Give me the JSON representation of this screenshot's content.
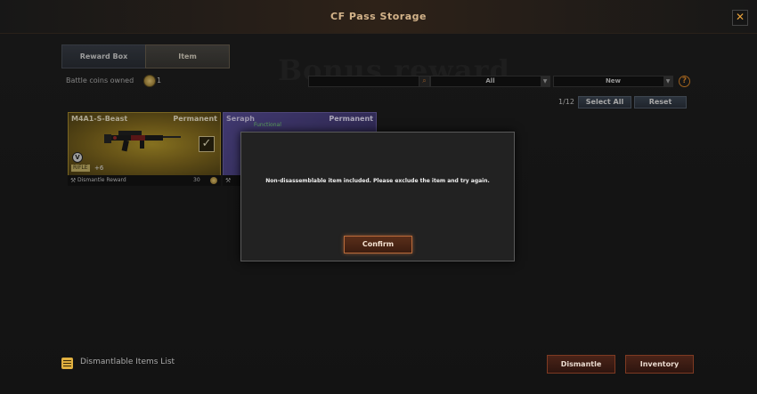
{
  "window": {
    "title": "CF Pass Storage",
    "close_glyph": "✕",
    "background_text": "Bonus reward"
  },
  "tabs": [
    {
      "label": "Reward Box",
      "active": false
    },
    {
      "label": "Item",
      "active": true
    }
  ],
  "coins": {
    "label": "Battle coins owned",
    "value": "1",
    "icon": "coin-icon"
  },
  "filters": {
    "search_value": "",
    "search_icon": "search-icon",
    "category_selected": "All",
    "sort_selected": "New",
    "help_glyph": "?"
  },
  "selection": {
    "count": "1/12",
    "select_all_label": "Select All",
    "reset_label": "Reset"
  },
  "items": [
    {
      "name": "M4A1-S-Beast",
      "duration": "Permanent",
      "category": "RIFLE",
      "upgrade": "+6",
      "checked": true,
      "footer_label": "Dismantle Reward",
      "footer_value": "30"
    },
    {
      "name": "Seraph",
      "duration": "Permanent",
      "tag": "Functional"
    }
  ],
  "dialog": {
    "message": "Non-disassemblable item included. Please exclude the item and try again.",
    "confirm_label": "Confirm"
  },
  "footer": {
    "list_label": "Dismantlable Items List",
    "dismantle_label": "Dismantle",
    "inventory_label": "Inventory"
  },
  "colors": {
    "accent": "#e08a2a",
    "title": "#d4b48a",
    "rare_gold": "#a88c30",
    "rare_purple": "#6c62a8"
  }
}
